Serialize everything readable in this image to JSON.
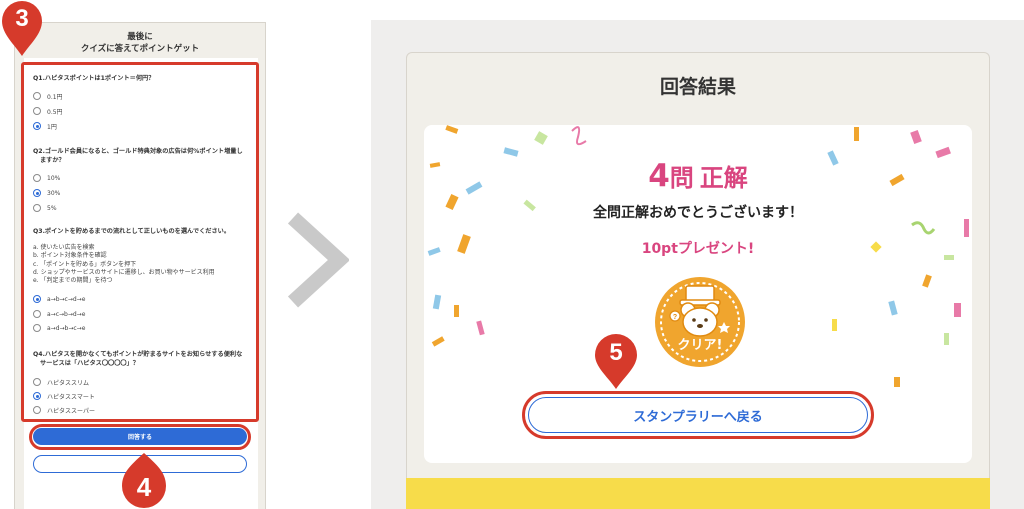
{
  "left": {
    "title_line1": "最後に",
    "title_line2": "クイズに答えてポイントゲット",
    "questions": [
      {
        "text": "Q1.ハピタスポイントは1ポイント＝何円？",
        "options": [
          "0.1円",
          "0.5円",
          "1円"
        ],
        "selected_index": 2
      },
      {
        "text_line1": "Q2.ゴールド会員になると、ゴールド特典対象の広告は何%ポイント増量し",
        "text_line2": "ますか？",
        "options": [
          "10%",
          "30%",
          "5%"
        ],
        "selected_index": 1
      },
      {
        "text": "Q3.ポイントを貯めるまでの流れとして正しいものを選んでください。",
        "steps": [
          "a. 使いたい広告を検索",
          "b. ポイント対象条件を確認",
          "c. 「ポイントを貯める」ボタンを押下",
          "d. ショップやサービスのサイトに遷移し、お買い物やサービス利用",
          "e. 「判定までの期間」を待つ"
        ],
        "options": [
          "a→b→c→d→e",
          "a→c→b→d→e",
          "a→d→b→c→e"
        ],
        "selected_index": 0
      },
      {
        "text_line1": "Q4.ハピタスを開かなくてもポイントが貯まるサイトをお知らせする便利な",
        "text_line2": "サービスは「ハピタス〇〇〇〇」？",
        "options": [
          "ハピタススリム",
          "ハピタススマート",
          "ハピタススーパー"
        ],
        "selected_index": 1
      }
    ],
    "submit_label": "回答する"
  },
  "markers": {
    "m3": "3",
    "m4": "4",
    "m5": "5"
  },
  "right": {
    "title": "回答結果",
    "score_number": "4",
    "score_unit": "問",
    "score_label": "正解",
    "congrats": "全問正解おめでとうございます！",
    "points": "10ptプレゼント!",
    "badge_text": "クリア!",
    "stamp_button": "スタンプラリーへ戻る"
  },
  "colors": {
    "accent_blue": "#2e6bd6",
    "highlight_red": "#d63a2b",
    "score_pink": "#d9457f",
    "badge_orange": "#f0a52e",
    "strip_yellow": "#f7dc4a"
  },
  "icons": [
    "chevron-right-icon",
    "map-pin-marker-icon",
    "clear-badge-icon"
  ]
}
